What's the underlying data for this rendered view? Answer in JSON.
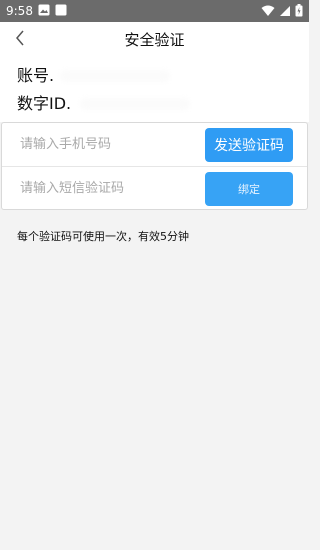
{
  "status_bar": {
    "time": "9:58",
    "left_icons": [
      "image-icon",
      "square-icon"
    ],
    "right_icons": [
      "wifi-icon",
      "signal-icon",
      "battery-charging-icon"
    ]
  },
  "header": {
    "title": "安全验证",
    "back_icon": "chevron-left-icon"
  },
  "account": {
    "account_label": "账号.",
    "id_label": "数字ID."
  },
  "form": {
    "phone_placeholder": "请输入手机号码",
    "phone_value": "",
    "send_code_label": "发送验证码",
    "sms_placeholder": "请输入短信验证码",
    "sms_value": "",
    "bind_label": "绑定"
  },
  "note": "每个验证码可使用一次，有效5分钟",
  "colors": {
    "primary": "#2f9cf4",
    "status_bar": "#6b6b6b",
    "background": "#f3f3f3"
  }
}
